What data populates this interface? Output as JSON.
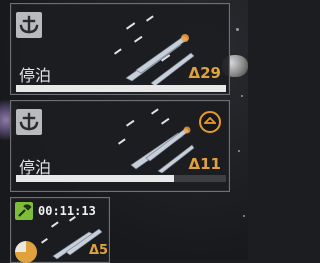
{
  "colors": {
    "accent": "#e0a23c",
    "timer_icon_bg": "#7ebd3a",
    "panel_border": "#6f7074"
  },
  "fleets": [
    {
      "status": "停泊",
      "fleet_label": "Δ29",
      "progress": 1.0,
      "status_icon": "anchor-icon"
    },
    {
      "status": "停泊",
      "fleet_label": "Δ11",
      "progress": 0.75,
      "status_icon": "anchor-icon",
      "action_icon": "collapse-chevron-icon"
    },
    {
      "timer": "00:11:13",
      "fleet_label": "Δ5",
      "progress": 0.75,
      "status_icon": "wrench-icon"
    }
  ]
}
